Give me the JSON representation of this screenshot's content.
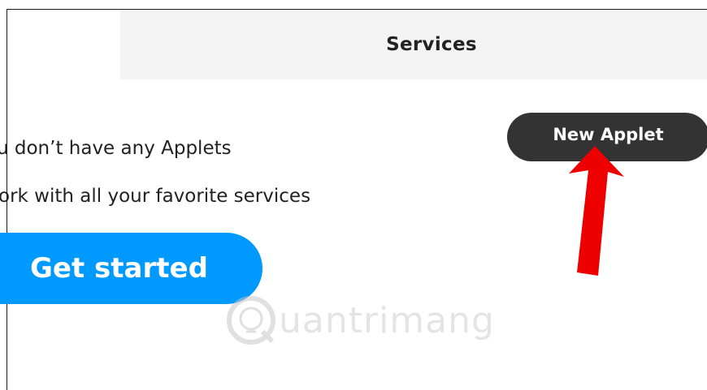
{
  "header": {
    "tab_label": "Services"
  },
  "empty_state": {
    "line1": "u don’t have any Applets",
    "line2": "ork with all your favorite services",
    "cta_label": "Get started"
  },
  "actions": {
    "new_applet_label": "New Applet"
  },
  "watermark": {
    "text": "uantrimang"
  },
  "colors": {
    "tab_bar_bg": "#f4f4f4",
    "cta_blue": "#0099ff",
    "new_applet_bg": "#333333",
    "annotation_arrow": "#ee0000"
  },
  "icons": {
    "annotation": "red-arrow-icon",
    "watermark_logo": "quantrimang-logo-icon"
  }
}
